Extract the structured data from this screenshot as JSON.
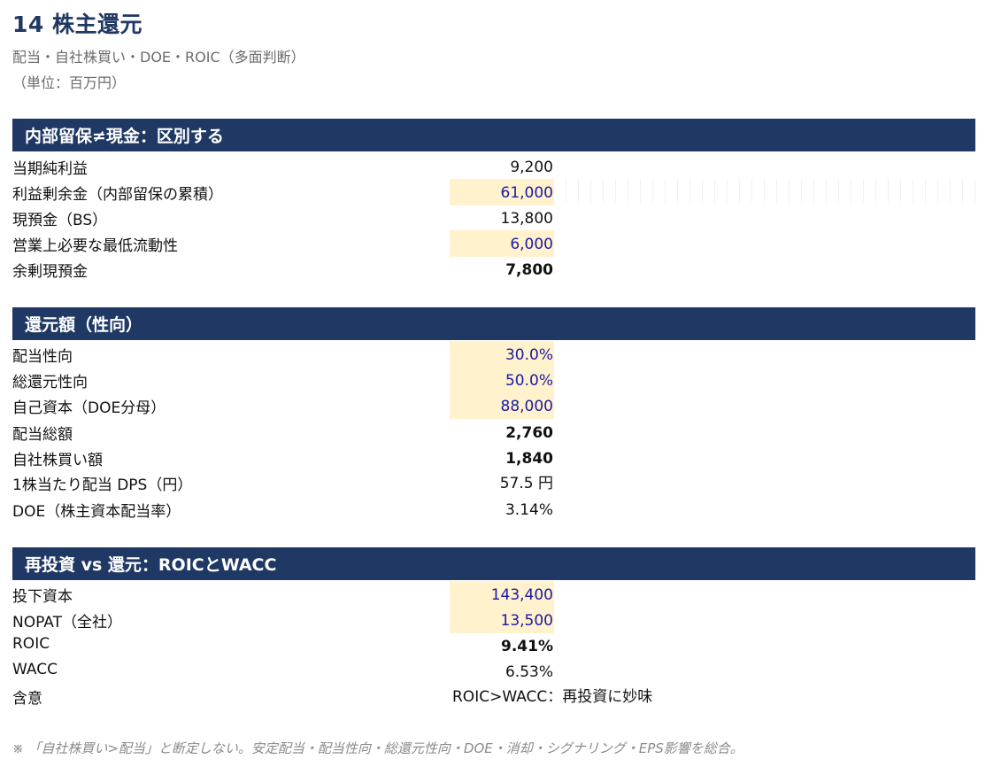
{
  "header": {
    "title": "14 株主還元",
    "subtitle": "配当・自社株買い・DOE・ROIC（多面判断）",
    "unit": "（単位：百万円）"
  },
  "sections": [
    {
      "title": "内部留保≠現金：区別する",
      "rows": [
        {
          "label": "当期純利益",
          "value": "9,200"
        },
        {
          "label": "利益剰余金（内部留保の累積）",
          "value": "61,000"
        },
        {
          "label": "現預金（BS）",
          "value": "13,800"
        },
        {
          "label": "営業上必要な最低流動性",
          "value": "6,000"
        },
        {
          "label": "余剰現預金",
          "value": "7,800"
        }
      ]
    },
    {
      "title": "還元額（性向）",
      "rows": [
        {
          "label": "配当性向",
          "value": "30.0%"
        },
        {
          "label": "総還元性向",
          "value": "50.0%"
        },
        {
          "label": "自己資本（DOE分母）",
          "value": "88,000"
        },
        {
          "label": "配当総額",
          "value": "2,760"
        },
        {
          "label": "自社株買い額",
          "value": "1,840"
        },
        {
          "label": "1株当たり配当 DPS（円）",
          "value": "57.5 円"
        },
        {
          "label": "DOE（株主資本配当率）",
          "value": "3.14%"
        }
      ]
    },
    {
      "title": "再投資 vs 還元：ROICとWACC",
      "rows": [
        {
          "label": "投下資本",
          "value": "143,400"
        },
        {
          "label": "NOPAT（全社）",
          "value": "13,500"
        },
        {
          "label": "ROIC",
          "value": "9.41%"
        },
        {
          "label": "WACC",
          "value": "6.53%"
        },
        {
          "label": "含意",
          "value": "ROIC>WACC：再投資に妙味"
        }
      ]
    }
  ],
  "note": "※ 「自社株買い>配当」と断定しない。安定配当・配当性向・総還元性向・DOE・消却・シグナリング・EPS影響を総合。",
  "colors": {
    "header_bg": "#1f3864",
    "input_bg": "#fff2cc",
    "input_text": "#1a1aa6"
  }
}
